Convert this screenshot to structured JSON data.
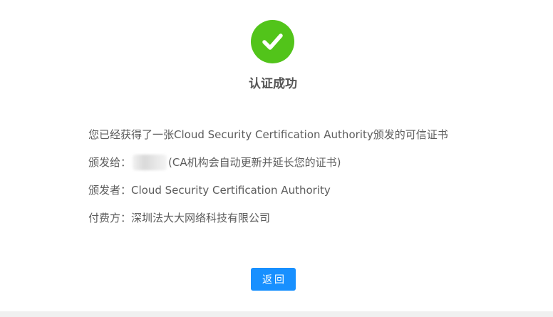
{
  "result": {
    "title": "认证成功",
    "icon": "check-circle-icon",
    "accent_color": "#52c41a"
  },
  "info": {
    "obtained_text": "您已经获得了一张Cloud Security Certification Authority颁发的可信证书",
    "issued_to_label": "颁发给：",
    "issued_to_note": "(CA机构会自动更新并延长您的证书)",
    "issuer_label": "颁发者：",
    "issuer_value": "Cloud Security Certification Authority",
    "payer_label": "付费方：",
    "payer_value": "深圳法大大网络科技有限公司"
  },
  "actions": {
    "back_label": "返回",
    "button_color": "#1890ff"
  }
}
